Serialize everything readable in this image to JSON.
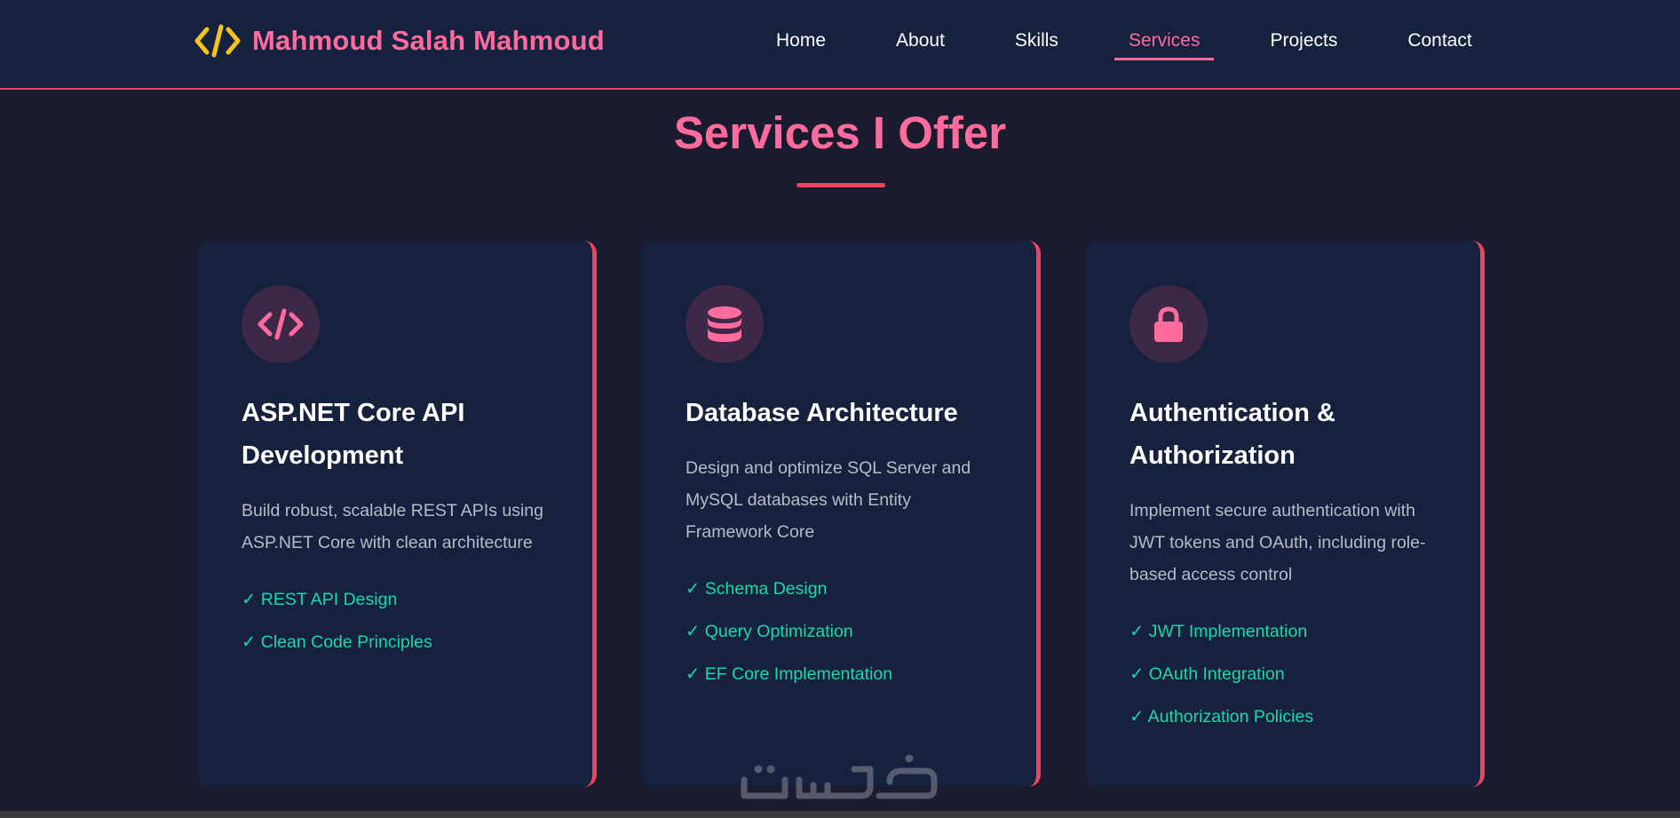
{
  "header": {
    "logo_text": "Mahmoud Salah Mahmoud",
    "logo_icon": "code-icon",
    "nav": [
      {
        "label": "Home",
        "active": false
      },
      {
        "label": "About",
        "active": false
      },
      {
        "label": "Skills",
        "active": false
      },
      {
        "label": "Services",
        "active": true
      },
      {
        "label": "Projects",
        "active": false
      },
      {
        "label": "Contact",
        "active": false
      }
    ]
  },
  "section": {
    "title": "Services I Offer"
  },
  "cards": [
    {
      "icon": "code-icon",
      "title": "ASP.NET Core API Development",
      "description": "Build robust, scalable REST APIs using ASP.NET Core with clean architecture",
      "features": [
        "✓ REST API Design",
        "✓ Clean Code Principles"
      ]
    },
    {
      "icon": "database-icon",
      "title": "Database Architecture",
      "description": "Design and optimize SQL Server and MySQL databases with Entity Framework Core",
      "features": [
        "✓ Schema Design",
        "✓ Query Optimization",
        "✓ EF Core Implementation"
      ]
    },
    {
      "icon": "lock-icon",
      "title": "Authentication & Authorization",
      "description": "Implement secure authentication with JWT tokens and OAuth, including role-based access control",
      "features": [
        "✓ JWT Implementation",
        "✓ OAuth Integration",
        "✓ Authorization Policies"
      ]
    }
  ],
  "watermark": {
    "text": "خمسات"
  },
  "colors": {
    "background": "#1a1b2e",
    "navbar": "#16213e",
    "card": "#16213e",
    "accent_pink": "#ff6b9d",
    "accent_red": "#e94560",
    "feature_green": "#16d9b0",
    "logo_yellow": "#f5c518",
    "icon_circle": "#3d2848"
  }
}
